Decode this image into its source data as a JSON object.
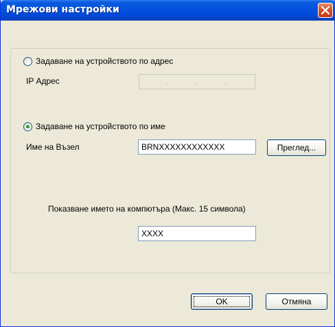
{
  "window": {
    "title": "Мрежови настройки"
  },
  "address_option": {
    "label": "Задаване на устройството по адрес",
    "selected": false,
    "ip_label": "IP Адрес",
    "ip_value": ""
  },
  "name_option": {
    "label": "Задаване на устройството по име",
    "selected": true,
    "node_label": "Име на Възел",
    "node_value": "BRNXXXXXXXXXXXX",
    "browse_button": "Преглед..."
  },
  "computer_name": {
    "label": "Показване името на компютъра (Макс. 15 символа)",
    "value": "XXXX"
  },
  "footer": {
    "ok_button": "OK",
    "cancel_button": "Отмяна"
  },
  "colors": {
    "titlebar": "#0453e0",
    "close_button": "#d8502c",
    "dialog_background": "#ece9d8",
    "radio_dot": "#21a121"
  }
}
